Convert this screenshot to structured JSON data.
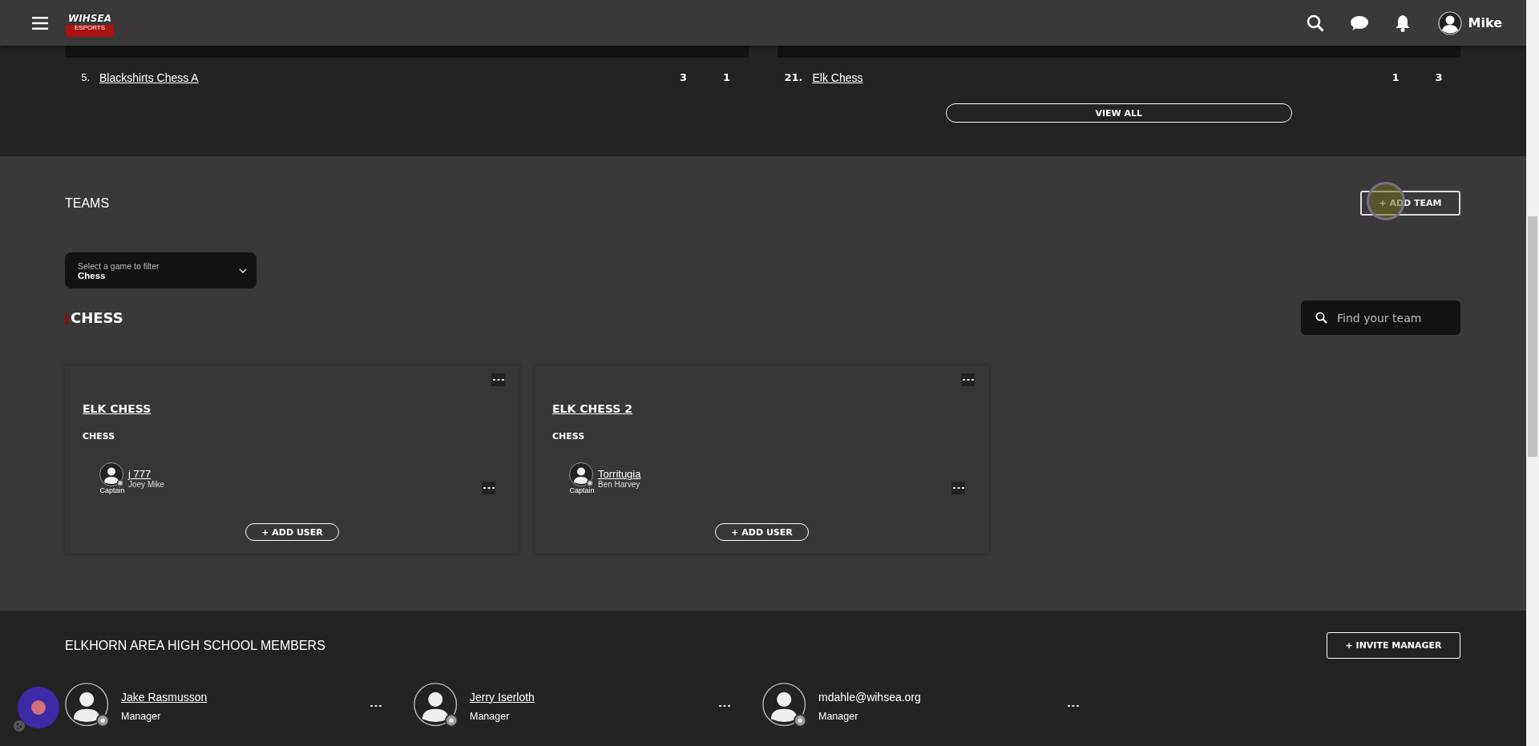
{
  "header": {
    "logo_title": "WIHSEA",
    "logo_subtitle": "ESPORTS",
    "user": "Mike"
  },
  "standings": {
    "tables": [
      {
        "rows": [
          {
            "rank": "5.",
            "team": "Blackshirts Chess A",
            "column_3": "3",
            "column_4": "1"
          }
        ]
      },
      {
        "rows": [
          {
            "rank": "21.",
            "team": "Elk Chess",
            "column_3": "1",
            "column_4": "3"
          }
        ]
      }
    ],
    "view_all": "VIEW ALL"
  },
  "teams": {
    "title": "TEAMS",
    "add_button": "+ ADD TEAM",
    "filter": {
      "label": "Select a game to filter",
      "value": "Chess"
    },
    "game_heading": "CHESS",
    "search": {
      "placeholder": "Find your team"
    },
    "cards": [
      {
        "name": "ELK CHESS",
        "game": "CHESS",
        "members": [
          {
            "role": "Captain",
            "username": "j 777",
            "real_name": "Joey Mike"
          }
        ],
        "add_user": "+ ADD USER"
      },
      {
        "name": "ELK CHESS 2",
        "game": "CHESS",
        "members": [
          {
            "role": "Captain",
            "username": "Torritugia",
            "real_name": "Ben Harvey"
          }
        ],
        "add_user": "+ ADD USER"
      }
    ]
  },
  "members": {
    "title": "ELKHORN AREA HIGH SCHOOL MEMBERS",
    "invite_button": "+ INVITE MANAGER",
    "people": [
      {
        "name": "Jake Rasmusson",
        "role": "Manager",
        "linked": true
      },
      {
        "name": "Jerry Iserloth",
        "role": "Manager",
        "linked": true
      },
      {
        "name": "mdahle@wihsea.org",
        "role": "Manager",
        "linked": false
      }
    ]
  }
}
